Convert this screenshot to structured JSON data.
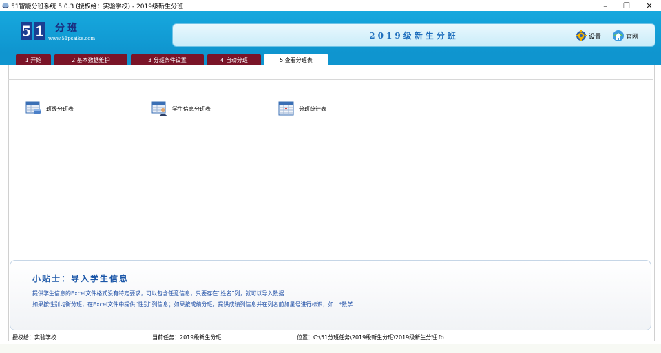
{
  "window": {
    "title": "51智能分班系统 5.0.3 (授权给：实验学校) - 2019级新生分班",
    "controls": {
      "minimize": "–",
      "maximize": "❐",
      "close": "✕"
    }
  },
  "header": {
    "logo": {
      "digit1": "5",
      "digit2": "1",
      "name": "分班",
      "url": "www.51psaike.com"
    },
    "banner_title": "2019级新生分班",
    "settings_label": "设置",
    "website_label": "官网"
  },
  "tabs": [
    {
      "label": "1 开始",
      "active": false
    },
    {
      "label": "2 基本数据维护",
      "active": false
    },
    {
      "label": "3 分班条件设置",
      "active": false
    },
    {
      "label": "4 自动分班",
      "active": false
    },
    {
      "label": "5 查看分班表",
      "active": true
    }
  ],
  "functions": [
    {
      "label": "班级分班表",
      "icon": "class-table-icon"
    },
    {
      "label": "学生信息分班表",
      "icon": "student-table-icon"
    },
    {
      "label": "分班统计表",
      "icon": "stats-table-icon"
    }
  ],
  "tips": {
    "title": "小贴士：导入学生信息",
    "line1": "提供学生信息的Excel文件格式没有特定要求，可以包含任意信息，只要存在“姓名”列，就可以导入数据",
    "line2": "如果按性别均衡分班，在Excel文件中提供“性别”列信息；如果按成绩分班，提供成绩列信息并在列名前加星号进行标识，如：*数学"
  },
  "status": {
    "license": "授权给：实验学校",
    "current_task": "当前任务：2019级新生分班",
    "location": "位置：C:\\51分班任务\\2019级新生分班\\2019级新生分班.fb"
  },
  "colors": {
    "header_blue": "#0f95cf",
    "tab_maroon": "#7a1428",
    "banner_text": "#1f6fbd",
    "tip_text": "#1e4ea6"
  }
}
